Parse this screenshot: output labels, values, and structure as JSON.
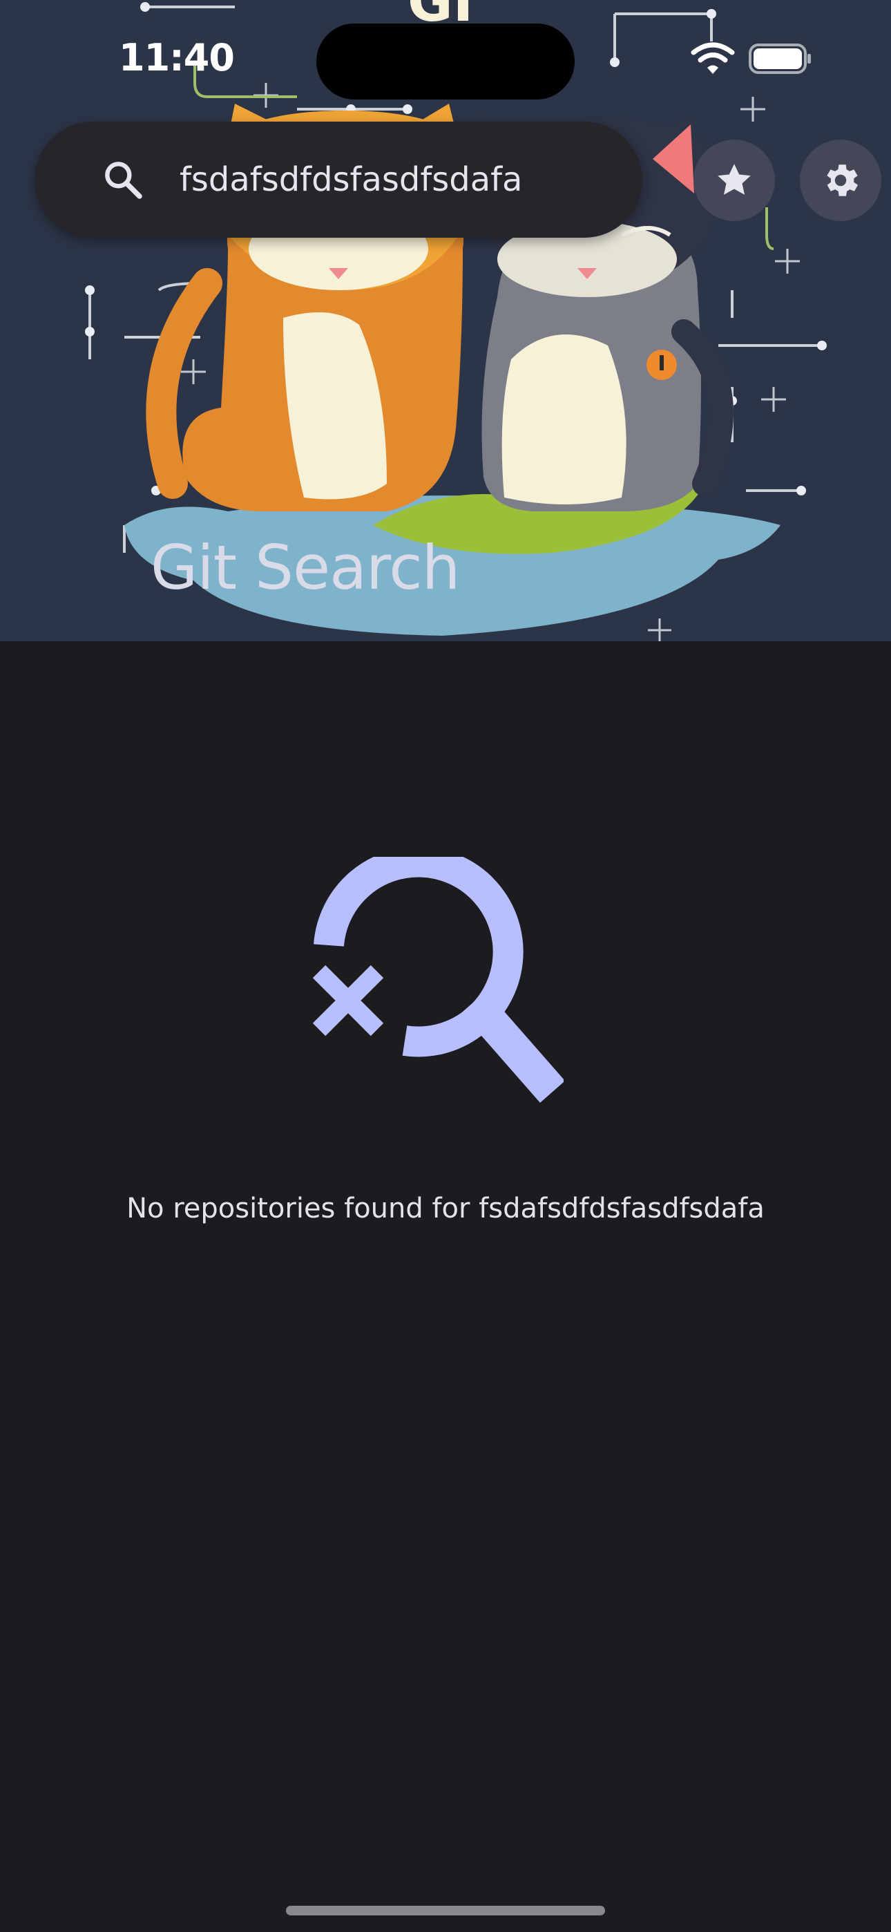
{
  "status_bar": {
    "time": "11:40",
    "icons": [
      "wifi-icon",
      "battery-icon"
    ]
  },
  "search": {
    "icon": "search-icon",
    "value": "fsdafsdfdsfasdfsdafa"
  },
  "actions": {
    "favorites_icon": "star-icon",
    "settings_icon": "gear-icon"
  },
  "banner": {
    "title": "Git Search",
    "illustration": "two-cats-illustration"
  },
  "empty_state": {
    "icon": "search-off-icon",
    "message": "No repositories found for fsdafsdfdsfasdfsdafa"
  },
  "colors": {
    "background": "#1c1b20",
    "banner_background": "#2c3548",
    "accent": "#b6befc",
    "search_bar": "#25252b",
    "round_button": "#434758"
  }
}
